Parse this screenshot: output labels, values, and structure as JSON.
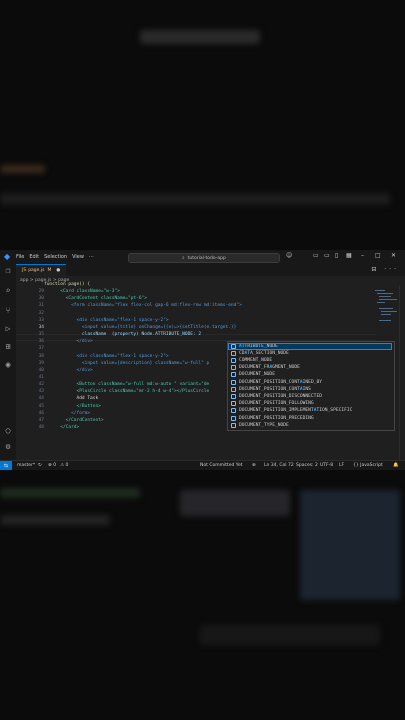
{
  "window": {
    "menu": [
      "File",
      "Edit",
      "Selection",
      "View",
      "···"
    ],
    "search_text": "tutorial-todo-app"
  },
  "tab": {
    "filename": "page.js",
    "status": "M"
  },
  "breadcrumb": [
    "app",
    ">",
    "page.js",
    ">",
    "page"
  ],
  "editor": {
    "lines": [
      {
        "n": "",
        "text": "function page() {"
      },
      {
        "n": "29",
        "text": "      <Card className=\"w-3\">"
      },
      {
        "n": "30",
        "text": "        <CardContent className=\"pt-6\">"
      },
      {
        "n": "31",
        "text": "          <form className=\"flex flex-col gap-6 md:flex-row md:items-end\">"
      },
      {
        "n": "32",
        "text": ""
      },
      {
        "n": "33",
        "text": "            <div className=\"flex-1 space-y-2\">"
      },
      {
        "n": "34",
        "text": "              <input value={title} onChange={(e)=>{setTitle(e.target.}}"
      },
      {
        "n": "35",
        "text": "              className  (property) Node.ATTRIBUTE_NODE: 2"
      },
      {
        "n": "36",
        "text": "            </div>"
      },
      {
        "n": "37",
        "text": ""
      },
      {
        "n": "38",
        "text": "            <div className=\"flex-1 space-y-2\">"
      },
      {
        "n": "39",
        "text": "              <input value={description} className=\"w-full\" p"
      },
      {
        "n": "40",
        "text": "            </div>"
      },
      {
        "n": "41",
        "text": ""
      },
      {
        "n": "42",
        "text": "            <Button className=\"w-full md:w-auto \" variant=\"de"
      },
      {
        "n": "43",
        "text": "            <PlusCircle className=\"mr-2 h-4 w-4\"></PlusCircle"
      },
      {
        "n": "44",
        "text": "            Add Task"
      },
      {
        "n": "45",
        "text": "            </Button>"
      },
      {
        "n": "46",
        "text": "          </form>"
      },
      {
        "n": "47",
        "text": "        </CardContent>"
      },
      {
        "n": "48",
        "text": "      </Card>"
      }
    ],
    "active_line": "34"
  },
  "suggestions": {
    "match": "A",
    "items": [
      "ATTRIBUTE_NODE",
      "CDATA_SECTION_NODE",
      "COMMENT_NODE",
      "DOCUMENT_FRAGMENT_NODE",
      "DOCUMENT_NODE",
      "DOCUMENT_POSITION_CONTAINED_BY",
      "DOCUMENT_POSITION_CONTAINS",
      "DOCUMENT_POSITION_DISCONNECTED",
      "DOCUMENT_POSITION_FOLLOWING",
      "DOCUMENT_POSITION_IMPLEMENTATION_SPECIFIC",
      "DOCUMENT_POSITION_PRECEDING",
      "DOCUMENT_TYPE_NODE"
    ],
    "selected": "ATTRIBUTE_NODE"
  },
  "status": {
    "branch": "master*",
    "errors": "⊗ 0",
    "warnings": "⚠ 34",
    "info": "⚠ 0",
    "commit": "Not Committed Yet",
    "position": "Ln 34, Col 72",
    "spaces": "Spaces: 2",
    "encoding": "UTF-8",
    "eol": "LF",
    "language": "{} JavaScript"
  },
  "colors": {
    "accent": "#0078d4",
    "selection": "#04395e",
    "match": "#2aaaff",
    "modified": "#e2c08d"
  },
  "icons": [
    "vscode-logo-icon",
    "explorer-icon",
    "search-icon",
    "source-control-icon",
    "run-debug-icon",
    "extensions-icon",
    "copilot-icon",
    "account-icon",
    "settings-icon",
    "property-icon"
  ]
}
